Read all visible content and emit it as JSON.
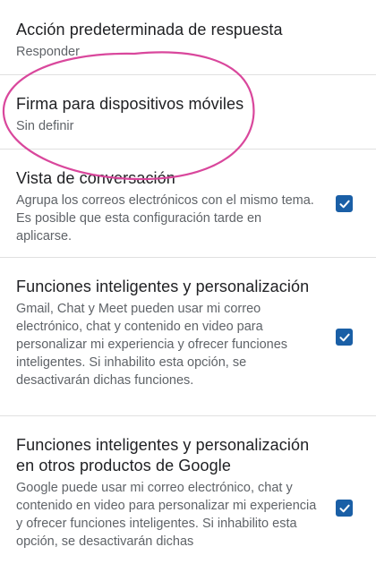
{
  "settings": {
    "reply_default": {
      "title": "Acción predeterminada de respuesta",
      "value": "Responder"
    },
    "mobile_signature": {
      "title": "Firma para dispositivos móviles",
      "value": "Sin definir"
    },
    "conversation_view": {
      "title": "Vista de conversación",
      "description": "Agrupa los correos electrónicos con el mismo tema. Es posible que esta configuración tarde en aplicarse.",
      "checked": true
    },
    "smart_features": {
      "title": "Funciones inteligentes y personalización",
      "description": "Gmail, Chat y Meet pueden usar mi correo electrónico, chat y contenido en video para personalizar mi experiencia y ofrecer funciones inteligentes. Si inhabilito esta opción, se desactivarán dichas funciones.",
      "checked": true
    },
    "smart_features_other": {
      "title": "Funciones inteligentes y personalización en otros productos de Google",
      "description": "Google puede usar mi correo electrónico, chat y contenido en video para personalizar mi experiencia y ofrecer funciones inteligentes. Si inhabilito esta opción, se desactivarán dichas",
      "checked": true
    }
  },
  "colors": {
    "checkbox_accent": "#1a5fa6",
    "annotation": "#d9479c",
    "divider": "#e0e0e0"
  },
  "icons": {
    "checkbox_check": "check-icon"
  }
}
